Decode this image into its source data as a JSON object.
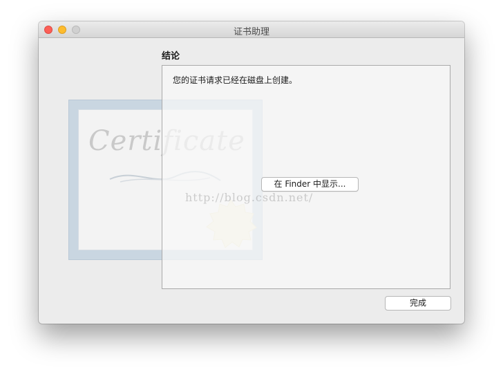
{
  "window": {
    "title": "证书助理"
  },
  "content": {
    "section_title": "结论",
    "message": "您的证书请求已经在磁盘上创建。",
    "show_in_finder_label": "在 Finder 中显示...",
    "watermark": "http://blog.csdn.net/"
  },
  "footer": {
    "done_label": "完成"
  },
  "artwork": {
    "script_text": "Certificate"
  },
  "icons": [
    "close-icon",
    "minimize-icon",
    "zoom-icon",
    "certificate-icon",
    "seal-icon"
  ],
  "colors": {
    "close": "#fc5f57",
    "minimize": "#fdbc2e",
    "zoom_disabled": "#d0d0d0"
  }
}
